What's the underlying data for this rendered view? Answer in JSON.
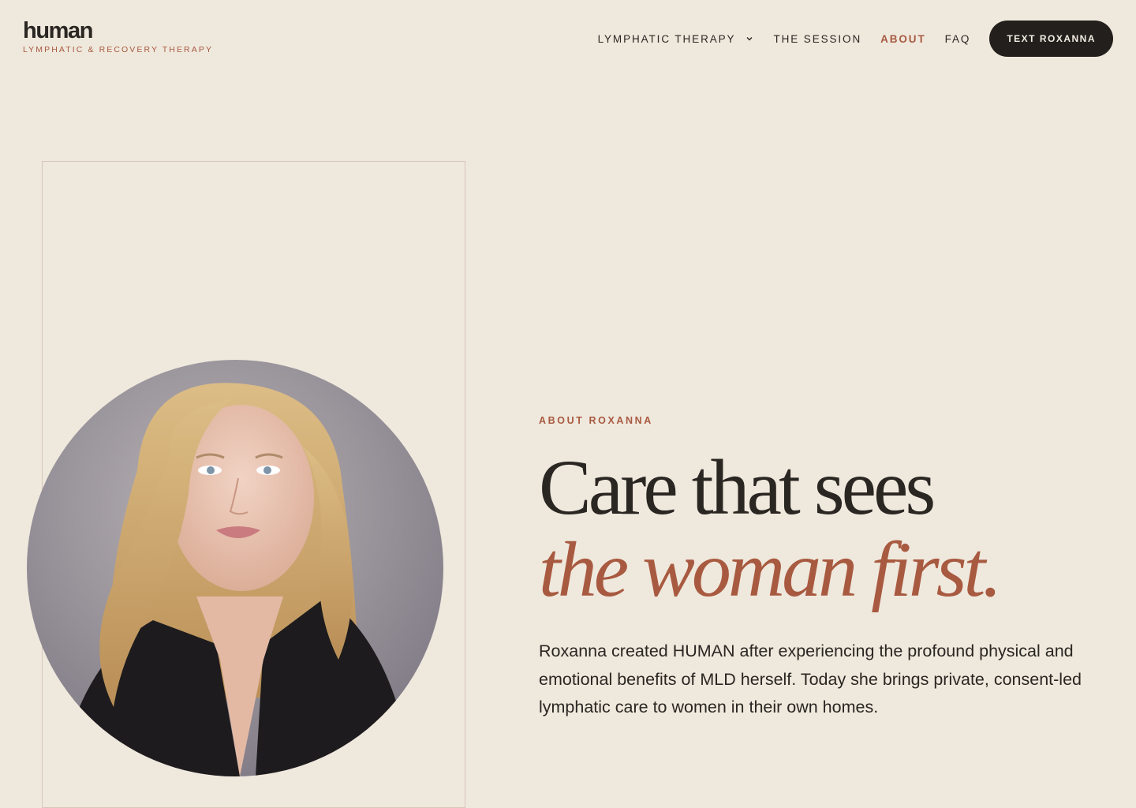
{
  "brand": {
    "name": "human",
    "tagline": "LYMPHATIC & RECOVERY THERAPY"
  },
  "nav": {
    "items": [
      {
        "label": "LYMPHATIC THERAPY",
        "has_dropdown": true,
        "active": false
      },
      {
        "label": "THE SESSION",
        "active": false
      },
      {
        "label": "ABOUT",
        "active": true
      },
      {
        "label": "FAQ",
        "active": false
      }
    ],
    "cta_label": "TEXT ROXANNA"
  },
  "hero": {
    "eyebrow": "ABOUT ROXANNA",
    "headline_line1": "Care that sees",
    "headline_line2": "the woman first.",
    "body": "Roxanna created HUMAN after experiencing the profound physical and emotional benefits of MLD herself. Today she brings private, consent-led lymphatic care to women in their own homes."
  },
  "colors": {
    "background": "#efe8dd",
    "accent": "#a85a40",
    "text": "#2a2622",
    "button": "#231f1c"
  },
  "icons": {
    "dropdown": "chevron-down-icon"
  }
}
